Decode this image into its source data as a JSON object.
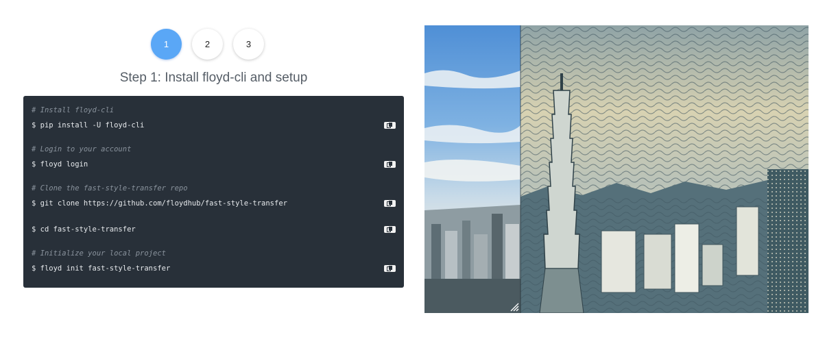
{
  "stepper": {
    "steps": [
      {
        "label": "1",
        "active": true
      },
      {
        "label": "2",
        "active": false
      },
      {
        "label": "3",
        "active": false
      }
    ],
    "accent_color": "#5aa7f6"
  },
  "step_title": "Step 1: Install floyd-cli and setup",
  "terminal": {
    "background": "#283039",
    "lines": [
      {
        "type": "comment",
        "text": "# Install floyd-cli"
      },
      {
        "type": "command",
        "text": "$ pip install -U floyd-cli"
      },
      {
        "type": "comment",
        "text": "# Login to your account"
      },
      {
        "type": "command",
        "text": "$ floyd login"
      },
      {
        "type": "comment",
        "text": "# Clone the fast-style-transfer repo"
      },
      {
        "type": "command",
        "text": "$ git clone https://github.com/floydhub/fast-style-transfer"
      },
      {
        "type": "command",
        "text": "$ cd fast-style-transfer"
      },
      {
        "type": "comment",
        "text": "# Initialize your local project"
      },
      {
        "type": "command",
        "text": "$ floyd init fast-style-transfer"
      }
    ],
    "copy_icon": "clipboard-icon"
  },
  "image": {
    "subject": "Taipei 101 skyline before/after style transfer",
    "handle_icon": "resize-handle-icon"
  }
}
